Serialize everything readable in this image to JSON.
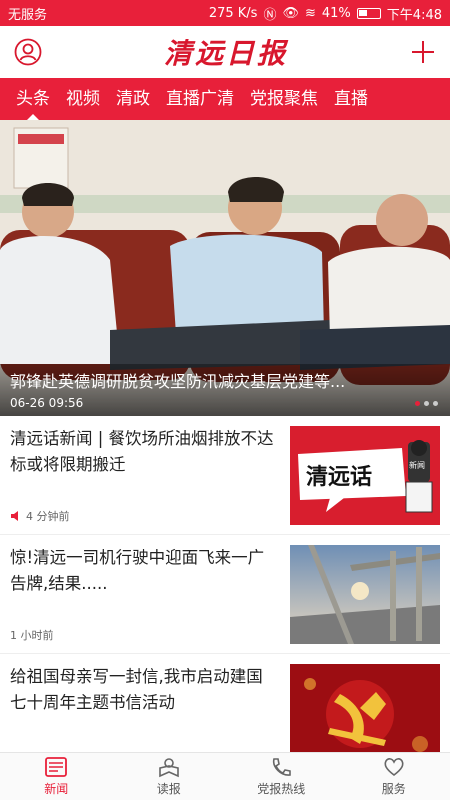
{
  "status_bar": {
    "carrier": "无服务",
    "speed": "275 K/s",
    "battery": "41%",
    "time": "下午4:48"
  },
  "header": {
    "logo_text": "清远日报",
    "user_icon": "user-icon",
    "add_icon": "plus-icon"
  },
  "tabs": [
    {
      "label": "头条",
      "active": true
    },
    {
      "label": "视频"
    },
    {
      "label": "清政"
    },
    {
      "label": "直播广清"
    },
    {
      "label": "党报聚焦"
    },
    {
      "label": "直播"
    }
  ],
  "hero": {
    "title": "郭锋赴英德调研脱贫攻坚防汛减灾基层党建等...",
    "date": "06-26 09:56"
  },
  "news": [
    {
      "title": "清远话新闻 | 餐饮场所油烟排放不达标或将限期搬迁",
      "meta": "4 分钟前",
      "thumb_text": "清远话",
      "thumb_tag": "新闻"
    },
    {
      "title": "惊!清远一司机行驶中迎面飞来一广告牌,结果.....",
      "meta": "1 小时前"
    },
    {
      "title": "给祖国母亲写一封信,我市启动建国七十周年主题书信活动",
      "meta": ""
    }
  ],
  "bottom_nav": [
    {
      "label": "新闻",
      "icon": "news-icon",
      "active": true
    },
    {
      "label": "读报",
      "icon": "read-paper-icon"
    },
    {
      "label": "党报热线",
      "icon": "hotline-icon"
    },
    {
      "label": "服务",
      "icon": "heart-icon"
    }
  ],
  "colors": {
    "brand": "#e8203a"
  }
}
